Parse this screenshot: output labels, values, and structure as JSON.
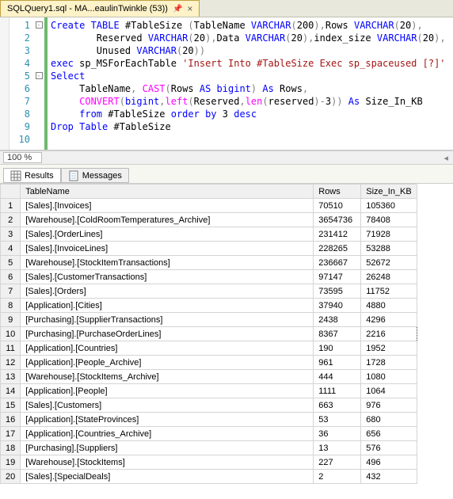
{
  "tab": {
    "title": "SQLQuery1.sql - MA...eaulinTwinkle (53))"
  },
  "editor": {
    "lines": [
      1,
      2,
      3,
      4,
      5,
      6,
      7,
      8,
      9,
      10
    ],
    "l1a": "Create",
    "l1b": " TABLE",
    "l1c": " #TableSize ",
    "l1d": "(",
    "l1e": "TableName ",
    "l1f": "VARCHAR",
    "l1g": "(",
    "l1h": "200",
    "l1i": "),",
    "l1j": "Rows ",
    "l1k": "VARCHAR",
    "l1l": "(",
    "l1m": "20",
    "l1n": "),",
    "l2a": "        Reserved ",
    "l2b": "VARCHAR",
    "l2c": "(",
    "l2d": "20",
    "l2e": "),",
    "l2f": "Data ",
    "l2g": "VARCHAR",
    "l2h": "(",
    "l2i": "20",
    "l2j": "),",
    "l2k": "index_size ",
    "l2l": "VARCHAR",
    "l2m": "(",
    "l2n": "20",
    "l2o": "),",
    "l3a": "        Unused ",
    "l3b": "VARCHAR",
    "l3c": "(",
    "l3d": "20",
    "l3e": "))",
    "l4a": "exec",
    "l4b": " sp_MSForEachTable ",
    "l4c": "'Insert Into #TableSize Exec sp_spaceused [?]'",
    "l5a": "Select",
    "l6a": "     TableName",
    "l6b": ",",
    "l6c": " CAST",
    "l6d": "(",
    "l6e": "Rows ",
    "l6f": "AS",
    "l6g": " bigint",
    "l6h": ")",
    "l6i": " As",
    "l6j": " Rows",
    "l6k": ",",
    "l7a": "     ",
    "l7b": "CONVERT",
    "l7c": "(",
    "l7d": "bigint",
    "l7e": ",",
    "l7f": "left",
    "l7g": "(",
    "l7h": "Reserved",
    "l7i": ",",
    "l7j": "len",
    "l7k": "(",
    "l7l": "reserved",
    "l7m": ")-",
    "l7n": "3",
    "l7o": "))",
    "l7p": " As",
    "l7q": " Size_In_KB",
    "l8a": "     ",
    "l8b": "from",
    "l8c": " #TableSize ",
    "l8d": "order",
    "l8e": " by",
    "l8f": " 3 ",
    "l8g": "desc",
    "l9a": "Drop",
    "l9b": " Table",
    "l9c": " #TableSize"
  },
  "zoom": {
    "value": "100 %"
  },
  "resultTabs": {
    "results": "Results",
    "messages": "Messages"
  },
  "grid": {
    "headers": {
      "name": "TableName",
      "rows": "Rows",
      "size": "Size_In_KB"
    },
    "rows": [
      {
        "n": "1",
        "name": "[Sales].[Invoices]",
        "rows": "70510",
        "size": "105360"
      },
      {
        "n": "2",
        "name": "[Warehouse].[ColdRoomTemperatures_Archive]",
        "rows": "3654736",
        "size": "78408"
      },
      {
        "n": "3",
        "name": "[Sales].[OrderLines]",
        "rows": "231412",
        "size": "71928"
      },
      {
        "n": "4",
        "name": "[Sales].[InvoiceLines]",
        "rows": "228265",
        "size": "53288"
      },
      {
        "n": "5",
        "name": "[Warehouse].[StockItemTransactions]",
        "rows": "236667",
        "size": "52672"
      },
      {
        "n": "6",
        "name": "[Sales].[CustomerTransactions]",
        "rows": "97147",
        "size": "26248"
      },
      {
        "n": "7",
        "name": "[Sales].[Orders]",
        "rows": "73595",
        "size": "11752"
      },
      {
        "n": "8",
        "name": "[Application].[Cities]",
        "rows": "37940",
        "size": "4880"
      },
      {
        "n": "9",
        "name": "[Purchasing].[SupplierTransactions]",
        "rows": "2438",
        "size": "4296"
      },
      {
        "n": "10",
        "name": "[Purchasing].[PurchaseOrderLines]",
        "rows": "8367",
        "size": "2216"
      },
      {
        "n": "11",
        "name": "[Application].[Countries]",
        "rows": "190",
        "size": "1952"
      },
      {
        "n": "12",
        "name": "[Application].[People_Archive]",
        "rows": "961",
        "size": "1728"
      },
      {
        "n": "13",
        "name": "[Warehouse].[StockItems_Archive]",
        "rows": "444",
        "size": "1080"
      },
      {
        "n": "14",
        "name": "[Application].[People]",
        "rows": "1111",
        "size": "1064"
      },
      {
        "n": "15",
        "name": "[Sales].[Customers]",
        "rows": "663",
        "size": "976"
      },
      {
        "n": "16",
        "name": "[Application].[StateProvinces]",
        "rows": "53",
        "size": "680"
      },
      {
        "n": "17",
        "name": "[Application].[Countries_Archive]",
        "rows": "36",
        "size": "656"
      },
      {
        "n": "18",
        "name": "[Purchasing].[Suppliers]",
        "rows": "13",
        "size": "576"
      },
      {
        "n": "19",
        "name": "[Warehouse].[StockItems]",
        "rows": "227",
        "size": "496"
      },
      {
        "n": "20",
        "name": "[Sales].[SpecialDeals]",
        "rows": "2",
        "size": "432"
      }
    ]
  },
  "selectedRow": 9
}
